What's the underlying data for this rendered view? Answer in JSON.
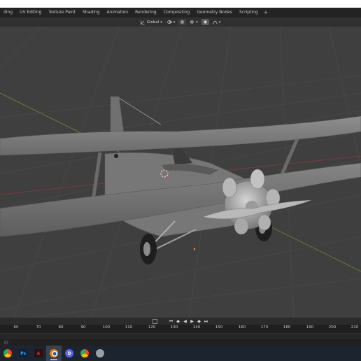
{
  "workspace_tabs": [
    "ding",
    "UV Editing",
    "Texture Paint",
    "Shading",
    "Animation",
    "Rendering",
    "Compositing",
    "Geometry Nodes",
    "Scripting"
  ],
  "add_tab_label": "+",
  "viewport_header": {
    "orientation_label": "Global",
    "transform_icon": "transform-orientation-icon",
    "snap_icon": "magnet-icon",
    "proportional_icon": "proportional-edit-icon"
  },
  "viewport": {
    "background": "#3f3f3f",
    "grid_color": "#4a4a4a",
    "x_axis_color": "#8a3a42",
    "y_axis_color": "#6b8a2a",
    "model_color": "#7d7d7d"
  },
  "playback": {
    "controls": [
      "jump-start-icon",
      "prev-keyframe-icon",
      "play-reverse-icon",
      "play-icon",
      "next-keyframe-icon",
      "jump-end-icon"
    ]
  },
  "timeline": {
    "ticks": [
      "60",
      "70",
      "80",
      "90",
      "100",
      "110",
      "120",
      "130",
      "140",
      "150",
      "160",
      "170",
      "180",
      "190",
      "200",
      "210"
    ]
  },
  "taskbar": {
    "apps": [
      {
        "name": "chrome",
        "glyph": "",
        "color": "#4caf50"
      },
      {
        "name": "photoshop",
        "glyph": "Ps",
        "color": "#0d1f3c"
      },
      {
        "name": "acrobat",
        "glyph": "A",
        "color": "#d93025"
      },
      {
        "name": "blender",
        "glyph": "",
        "color": "#e87d0d",
        "active": true
      },
      {
        "name": "discord",
        "glyph": "D",
        "color": "#5865f2"
      },
      {
        "name": "chrome-2",
        "glyph": "",
        "color": "#fbbc05"
      },
      {
        "name": "app-misc",
        "glyph": "",
        "color": "#9aa0a6"
      }
    ]
  }
}
